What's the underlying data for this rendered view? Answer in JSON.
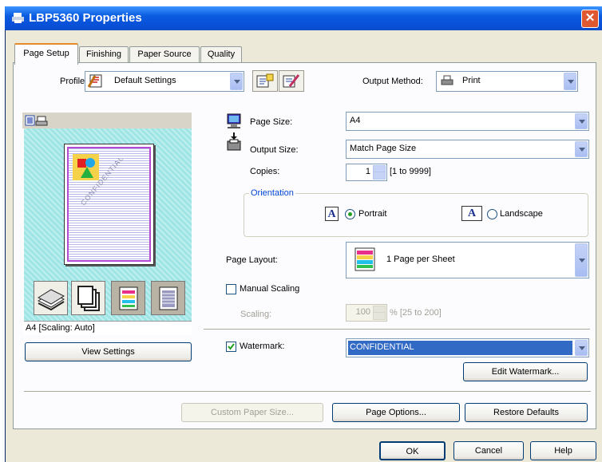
{
  "window": {
    "title": "LBP5360 Properties",
    "close_glyph": "✕"
  },
  "tabs": [
    {
      "label": "Page Setup",
      "active": true
    },
    {
      "label": "Finishing",
      "active": false
    },
    {
      "label": "Paper Source",
      "active": false
    },
    {
      "label": "Quality",
      "active": false
    }
  ],
  "profile": {
    "label": "Profile:",
    "value": "Default Settings"
  },
  "output_method": {
    "label": "Output Method:",
    "value": "Print"
  },
  "preview": {
    "status": "A4 [Scaling: Auto]",
    "watermark_text": "CONFIDENTIAL",
    "view_settings_label": "View Settings"
  },
  "page_size": {
    "label": "Page Size:",
    "value": "A4"
  },
  "output_size": {
    "label": "Output Size:",
    "value": "Match Page Size"
  },
  "copies": {
    "label": "Copies:",
    "value": "1",
    "range": "[1 to 9999]"
  },
  "orientation": {
    "label": "Orientation",
    "portrait_label": "Portrait",
    "landscape_label": "Landscape",
    "letter": "A"
  },
  "page_layout": {
    "label": "Page Layout:",
    "value": "1 Page per Sheet"
  },
  "manual_scaling": {
    "label": "Manual Scaling",
    "checked": false
  },
  "scaling": {
    "label": "Scaling:",
    "value": "100",
    "range": "% [25 to 200]"
  },
  "watermark": {
    "label": "Watermark:",
    "checked": true,
    "value": "CONFIDENTIAL",
    "edit_label": "Edit Watermark..."
  },
  "buttons": {
    "custom_paper_size": "Custom Paper Size...",
    "page_options": "Page Options...",
    "restore_defaults": "Restore Defaults",
    "ok": "OK",
    "cancel": "Cancel",
    "help": "Help"
  },
  "colors": {
    "title_bar": "#0a5ce0",
    "tab_highlight": "#e68b2c",
    "selection": "#316ac5",
    "preview_bg": "#9ee5e6"
  }
}
